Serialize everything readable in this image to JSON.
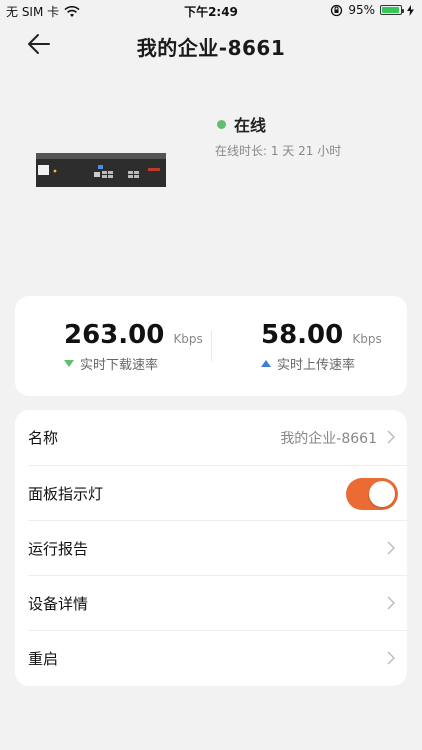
{
  "statusbar": {
    "carrier": "无 SIM 卡",
    "time": "下午2:49",
    "battery_text": "95%",
    "battery_level": 0.95
  },
  "header": {
    "title": "我的企业-8661",
    "back_icon": "back-arrow-icon"
  },
  "device": {
    "status": "在线",
    "status_color": "#5fbf6a",
    "uptime": "在线时长: 1 天 21 小时"
  },
  "speed": {
    "download": {
      "value": "263.00",
      "unit": "Kbps",
      "label": "实时下载速率"
    },
    "upload": {
      "value": "58.00",
      "unit": "Kbps",
      "label": "实时上传速率"
    }
  },
  "menu": {
    "name_label": "名称",
    "name_value": "我的企业-8661",
    "led_label": "面板指示灯",
    "led_on": true,
    "report_label": "运行报告",
    "details_label": "设备详情",
    "reboot_label": "重启"
  },
  "colors": {
    "accent": "#ea6b33",
    "online": "#5fbf6a",
    "upload": "#3f7fd6"
  }
}
